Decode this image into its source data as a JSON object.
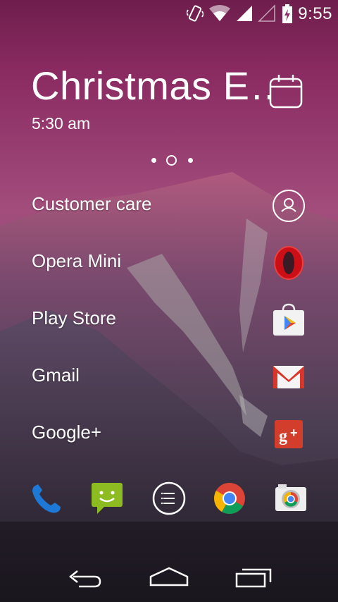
{
  "status_bar": {
    "time": "9:55",
    "icons": [
      "vibrate-icon",
      "wifi-icon",
      "signal-icon",
      "no-signal-icon",
      "battery-charging-icon"
    ]
  },
  "agenda": {
    "title": "Christmas E…",
    "time": "5:30 am",
    "icon": "calendar-icon"
  },
  "pager": {
    "pages": 3,
    "current": 2
  },
  "shortcuts": [
    {
      "label": "Customer care",
      "icon": "person-icon"
    },
    {
      "label": "Opera Mini",
      "icon": "opera-icon"
    },
    {
      "label": "Play Store",
      "icon": "play-store-icon"
    },
    {
      "label": "Gmail",
      "icon": "gmail-icon"
    },
    {
      "label": "Google+",
      "icon": "google-plus-icon"
    }
  ],
  "dock": [
    "phone-icon",
    "messaging-icon",
    "app-drawer-icon",
    "chrome-icon",
    "camera-icon"
  ],
  "nav": [
    "back-icon",
    "home-icon",
    "recents-icon"
  ],
  "colors": {
    "sky_top": "#8a2b62",
    "sky_mid": "#a24d7c",
    "opera_red": "#cc0f16",
    "gmail_red": "#d8362a",
    "gplus_red": "#d23e2b",
    "messaging_green": "#8dbb22",
    "phone_blue": "#1e78d6"
  }
}
